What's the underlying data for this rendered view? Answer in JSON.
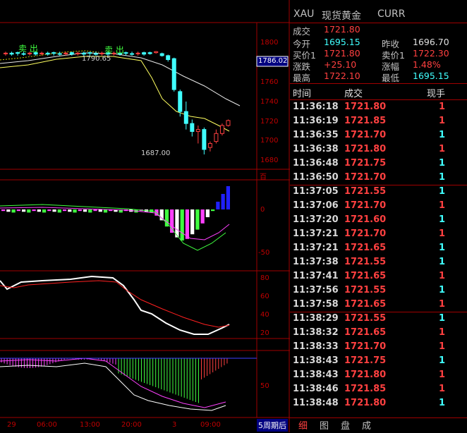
{
  "chart_axis": {
    "price_ticks": [
      "1800",
      "1780",
      "1760",
      "1740",
      "1720",
      "1700",
      "1680"
    ],
    "price_box": "1786.02",
    "ind1_ticks": [
      "0",
      "-50"
    ],
    "ind1_top": "百",
    "ind2_ticks": [
      "80",
      "60",
      "40",
      "20"
    ],
    "ind3_ticks": [
      "50"
    ],
    "time_ticks": [
      "29",
      "06:00",
      "13:00",
      "20:00",
      "3",
      "09:00"
    ],
    "period_label": "5周期后",
    "hi_label": "1790.65",
    "lo_label": "1687.00",
    "sell_label_1": "卖 出",
    "sell_label_2": "卖 出"
  },
  "chart_data": {
    "type": "candlestick",
    "title": "",
    "ylim": [
      1675,
      1805
    ],
    "annotations": {
      "high": 1790.65,
      "low": 1687.0,
      "last": 1786.02
    },
    "candles": [
      {
        "o": 1789,
        "h": 1790,
        "l": 1787,
        "c": 1788
      },
      {
        "o": 1789,
        "h": 1790.65,
        "l": 1788,
        "c": 1790
      },
      {
        "o": 1788,
        "h": 1789,
        "l": 1785,
        "c": 1786
      },
      {
        "o": 1786,
        "h": 1787,
        "l": 1780,
        "c": 1782
      },
      {
        "o": 1783,
        "h": 1784,
        "l": 1750,
        "c": 1752
      },
      {
        "o": 1750,
        "h": 1752,
        "l": 1725,
        "c": 1730
      },
      {
        "o": 1730,
        "h": 1740,
        "l": 1712,
        "c": 1718
      },
      {
        "o": 1718,
        "h": 1722,
        "l": 1705,
        "c": 1710
      },
      {
        "o": 1710,
        "h": 1716,
        "l": 1698,
        "c": 1712
      },
      {
        "o": 1712,
        "h": 1714,
        "l": 1687,
        "c": 1692
      },
      {
        "o": 1694,
        "h": 1700,
        "l": 1690,
        "c": 1698
      },
      {
        "o": 1700,
        "h": 1712,
        "l": 1698,
        "c": 1708
      },
      {
        "o": 1708,
        "h": 1718,
        "l": 1706,
        "c": 1716
      },
      {
        "o": 1716,
        "h": 1722,
        "l": 1715,
        "c": 1721
      }
    ]
  },
  "header": {
    "symbol": "XAU",
    "name": "现货黄金",
    "market": "CURR"
  },
  "quote": {
    "last_label": "成交",
    "last_value": "1721.80",
    "open_label": "今开",
    "open_value": "1695.15",
    "prev_label": "昨收",
    "prev_value": "1696.70",
    "bid_label": "买价1",
    "bid_value": "1721.80",
    "ask_label": "卖价1",
    "ask_value": "1722.30",
    "chg_label": "涨跌",
    "chg_value": "+25.10",
    "pct_label": "涨幅",
    "pct_value": "1.48%",
    "high_label": "最高",
    "high_value": "1722.10",
    "low_label": "最低",
    "low_value": "1695.15"
  },
  "ticks_header": {
    "time": "时间",
    "price": "成交",
    "vol": "现手"
  },
  "ticks": [
    {
      "time": "11:36:18",
      "price": "1721.80",
      "vol": "1",
      "dir": "red"
    },
    {
      "time": "11:36:19",
      "price": "1721.85",
      "vol": "1",
      "dir": "red"
    },
    {
      "time": "11:36:35",
      "price": "1721.70",
      "vol": "1",
      "dir": "cyan"
    },
    {
      "time": "11:36:38",
      "price": "1721.80",
      "vol": "1",
      "dir": "red"
    },
    {
      "time": "11:36:48",
      "price": "1721.75",
      "vol": "1",
      "dir": "cyan"
    },
    {
      "time": "11:36:50",
      "price": "1721.70",
      "vol": "1",
      "dir": "cyan"
    },
    {
      "time": "11:37:05",
      "price": "1721.55",
      "vol": "1",
      "dir": "cyan"
    },
    {
      "time": "11:37:06",
      "price": "1721.70",
      "vol": "1",
      "dir": "red"
    },
    {
      "time": "11:37:20",
      "price": "1721.60",
      "vol": "1",
      "dir": "cyan"
    },
    {
      "time": "11:37:21",
      "price": "1721.70",
      "vol": "1",
      "dir": "red"
    },
    {
      "time": "11:37:21",
      "price": "1721.65",
      "vol": "1",
      "dir": "cyan"
    },
    {
      "time": "11:37:38",
      "price": "1721.55",
      "vol": "1",
      "dir": "cyan"
    },
    {
      "time": "11:37:41",
      "price": "1721.65",
      "vol": "1",
      "dir": "red"
    },
    {
      "time": "11:37:56",
      "price": "1721.55",
      "vol": "1",
      "dir": "cyan"
    },
    {
      "time": "11:37:58",
      "price": "1721.65",
      "vol": "1",
      "dir": "red"
    },
    {
      "time": "11:38:29",
      "price": "1721.55",
      "vol": "1",
      "dir": "cyan"
    },
    {
      "time": "11:38:32",
      "price": "1721.65",
      "vol": "1",
      "dir": "red"
    },
    {
      "time": "11:38:33",
      "price": "1721.70",
      "vol": "1",
      "dir": "red"
    },
    {
      "time": "11:38:43",
      "price": "1721.75",
      "vol": "1",
      "dir": "cyan"
    },
    {
      "time": "11:38:43",
      "price": "1721.80",
      "vol": "1",
      "dir": "red"
    },
    {
      "time": "11:38:46",
      "price": "1721.85",
      "vol": "1",
      "dir": "red"
    },
    {
      "time": "11:38:48",
      "price": "1721.80",
      "vol": "1",
      "dir": "cyan"
    }
  ],
  "tabs": [
    "细",
    "图",
    "盘",
    "成"
  ],
  "colors": {
    "up": "#ff4040",
    "down": "#40ffff",
    "grid": "#a00000",
    "accent": "#ff3030"
  }
}
